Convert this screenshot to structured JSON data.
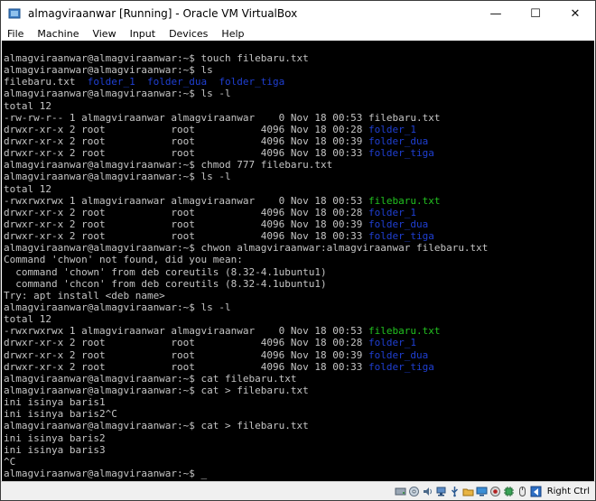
{
  "window": {
    "title": "almagviraanwar [Running] - Oracle VM VirtualBox",
    "minimize_glyph": "—",
    "maximize_glyph": "☐",
    "close_glyph": "✕"
  },
  "menu": {
    "items": [
      {
        "id": "file",
        "label": "File"
      },
      {
        "id": "machine",
        "label": "Machine"
      },
      {
        "id": "view",
        "label": "View"
      },
      {
        "id": "input",
        "label": "Input"
      },
      {
        "id": "devices",
        "label": "Devices"
      },
      {
        "id": "help",
        "label": "Help"
      }
    ]
  },
  "colors": {
    "terminal_bg": "#000000",
    "text": "#c5c5c5",
    "directory": "#1f3fd2",
    "executable": "#22c020",
    "accent_blue": "#1a5fb4"
  },
  "terminal": {
    "lines": [
      [
        {
          "t": "almagviraanwar@almagviraanwar:~$ touch filebaru.txt",
          "c": "def"
        }
      ],
      [
        {
          "t": "almagviraanwar@almagviraanwar:~$ ls",
          "c": "def"
        }
      ],
      [
        {
          "t": "filebaru.txt  ",
          "c": "def"
        },
        {
          "t": "folder_1",
          "c": "dir"
        },
        {
          "t": "  ",
          "c": "def"
        },
        {
          "t": "folder_dua",
          "c": "dir"
        },
        {
          "t": "  ",
          "c": "def"
        },
        {
          "t": "folder_tiga",
          "c": "dir"
        }
      ],
      [
        {
          "t": "almagviraanwar@almagviraanwar:~$ ls -l",
          "c": "def"
        }
      ],
      [
        {
          "t": "total 12",
          "c": "def"
        }
      ],
      [
        {
          "t": "-rw-rw-r-- 1 almagviraanwar almagviraanwar    0 Nov 18 00:53 filebaru.txt",
          "c": "def"
        }
      ],
      [
        {
          "t": "drwxr-xr-x 2 root           root           4096 Nov 18 00:28 ",
          "c": "def"
        },
        {
          "t": "folder_1",
          "c": "dir"
        }
      ],
      [
        {
          "t": "drwxr-xr-x 2 root           root           4096 Nov 18 00:39 ",
          "c": "def"
        },
        {
          "t": "folder_dua",
          "c": "dir"
        }
      ],
      [
        {
          "t": "drwxr-xr-x 2 root           root           4096 Nov 18 00:33 ",
          "c": "def"
        },
        {
          "t": "folder_tiga",
          "c": "dir"
        }
      ],
      [
        {
          "t": "almagviraanwar@almagviraanwar:~$ chmod 777 filebaru.txt",
          "c": "def"
        }
      ],
      [
        {
          "t": "almagviraanwar@almagviraanwar:~$ ls -l",
          "c": "def"
        }
      ],
      [
        {
          "t": "total 12",
          "c": "def"
        }
      ],
      [
        {
          "t": "-rwxrwxrwx 1 almagviraanwar almagviraanwar    0 Nov 18 00:53 ",
          "c": "def"
        },
        {
          "t": "filebaru.txt",
          "c": "exe"
        }
      ],
      [
        {
          "t": "drwxr-xr-x 2 root           root           4096 Nov 18 00:28 ",
          "c": "def"
        },
        {
          "t": "folder_1",
          "c": "dir"
        }
      ],
      [
        {
          "t": "drwxr-xr-x 2 root           root           4096 Nov 18 00:39 ",
          "c": "def"
        },
        {
          "t": "folder_dua",
          "c": "dir"
        }
      ],
      [
        {
          "t": "drwxr-xr-x 2 root           root           4096 Nov 18 00:33 ",
          "c": "def"
        },
        {
          "t": "folder_tiga",
          "c": "dir"
        }
      ],
      [
        {
          "t": "almagviraanwar@almagviraanwar:~$ chwon almagviraanwar:almagviraanwar filebaru.txt",
          "c": "def"
        }
      ],
      [
        {
          "t": "Command 'chwon' not found, did you mean:",
          "c": "def"
        }
      ],
      [
        {
          "t": "  command 'chown' from deb coreutils (8.32-4.1ubuntu1)",
          "c": "def"
        }
      ],
      [
        {
          "t": "  command 'chcon' from deb coreutils (8.32-4.1ubuntu1)",
          "c": "def"
        }
      ],
      [
        {
          "t": "Try: apt install <deb name>",
          "c": "def"
        }
      ],
      [
        {
          "t": "almagviraanwar@almagviraanwar:~$ ls -l",
          "c": "def"
        }
      ],
      [
        {
          "t": "total 12",
          "c": "def"
        }
      ],
      [
        {
          "t": "-rwxrwxrwx 1 almagviraanwar almagviraanwar    0 Nov 18 00:53 ",
          "c": "def"
        },
        {
          "t": "filebaru.txt",
          "c": "exe"
        }
      ],
      [
        {
          "t": "drwxr-xr-x 2 root           root           4096 Nov 18 00:28 ",
          "c": "def"
        },
        {
          "t": "folder_1",
          "c": "dir"
        }
      ],
      [
        {
          "t": "drwxr-xr-x 2 root           root           4096 Nov 18 00:39 ",
          "c": "def"
        },
        {
          "t": "folder_dua",
          "c": "dir"
        }
      ],
      [
        {
          "t": "drwxr-xr-x 2 root           root           4096 Nov 18 00:33 ",
          "c": "def"
        },
        {
          "t": "folder_tiga",
          "c": "dir"
        }
      ],
      [
        {
          "t": "almagviraanwar@almagviraanwar:~$ cat filebaru.txt",
          "c": "def"
        }
      ],
      [
        {
          "t": "almagviraanwar@almagviraanwar:~$ cat > filebaru.txt",
          "c": "def"
        }
      ],
      [
        {
          "t": "ini isinya baris1",
          "c": "def"
        }
      ],
      [
        {
          "t": "ini isinya baris2^C",
          "c": "def"
        }
      ],
      [
        {
          "t": "almagviraanwar@almagviraanwar:~$ cat > filebaru.txt",
          "c": "def"
        }
      ],
      [
        {
          "t": "ini isinya baris2",
          "c": "def"
        }
      ],
      [
        {
          "t": "ini isinya baris3",
          "c": "def"
        }
      ],
      [
        {
          "t": "^C",
          "c": "def"
        }
      ],
      [
        {
          "t": "almagviraanwar@almagviraanwar:~$ ",
          "c": "def"
        },
        {
          "t": "_",
          "c": "cur"
        }
      ]
    ]
  },
  "status_bar": {
    "icons": [
      "harddisk-icon",
      "optical-drive-icon",
      "audio-icon",
      "network-icon",
      "usb-icon",
      "shared-folders-icon",
      "display-icon",
      "video-capture-icon",
      "vm-processor-icon",
      "mouse-integration-icon",
      "keyboard-arrow-icon"
    ],
    "host_key": "Right Ctrl"
  }
}
